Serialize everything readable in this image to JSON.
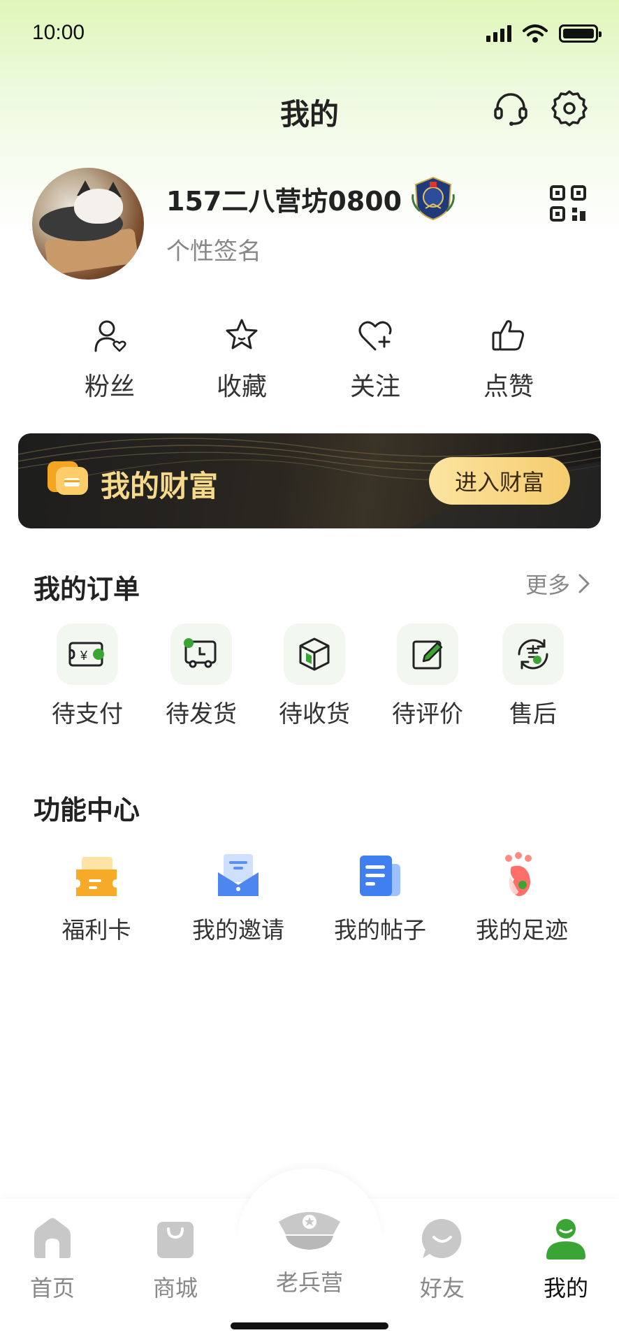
{
  "status_bar": {
    "time": "10:00"
  },
  "header": {
    "title": "我的"
  },
  "profile": {
    "username": "157二八营坊0800",
    "signature": "个性签名"
  },
  "quick_actions": [
    {
      "label": "粉丝",
      "icon": "fans-icon"
    },
    {
      "label": "收藏",
      "icon": "star-icon"
    },
    {
      "label": "关注",
      "icon": "heart-plus-icon"
    },
    {
      "label": "点赞",
      "icon": "thumbs-up-icon"
    }
  ],
  "wealth": {
    "title": "我的财富",
    "button": "进入财富"
  },
  "orders": {
    "title": "我的订单",
    "more": "更多",
    "items": [
      {
        "label": "待支付",
        "icon": "payment-icon"
      },
      {
        "label": "待发货",
        "icon": "truck-icon"
      },
      {
        "label": "待收货",
        "icon": "package-icon"
      },
      {
        "label": "待评价",
        "icon": "edit-icon"
      },
      {
        "label": "售后",
        "icon": "after-sale-icon"
      }
    ]
  },
  "functions": {
    "title": "功能中心",
    "items": [
      {
        "label": "福利卡",
        "icon": "welfare-card-icon"
      },
      {
        "label": "我的邀请",
        "icon": "invite-icon"
      },
      {
        "label": "我的帖子",
        "icon": "posts-icon"
      },
      {
        "label": "我的足迹",
        "icon": "footprint-icon"
      }
    ]
  },
  "tabbar": {
    "items": [
      {
        "label": "首页",
        "icon": "home-icon"
      },
      {
        "label": "商城",
        "icon": "shop-bag-icon"
      },
      {
        "label": "老兵营",
        "icon": "police-cap-icon"
      },
      {
        "label": "好友",
        "icon": "chat-bubble-icon"
      },
      {
        "label": "我的",
        "icon": "user-icon",
        "active": true
      }
    ]
  },
  "colors": {
    "accent_green": "#3aa534",
    "gold": "#f7d98a",
    "button_gold": "#f5cc6e",
    "text_gray": "#888888"
  }
}
